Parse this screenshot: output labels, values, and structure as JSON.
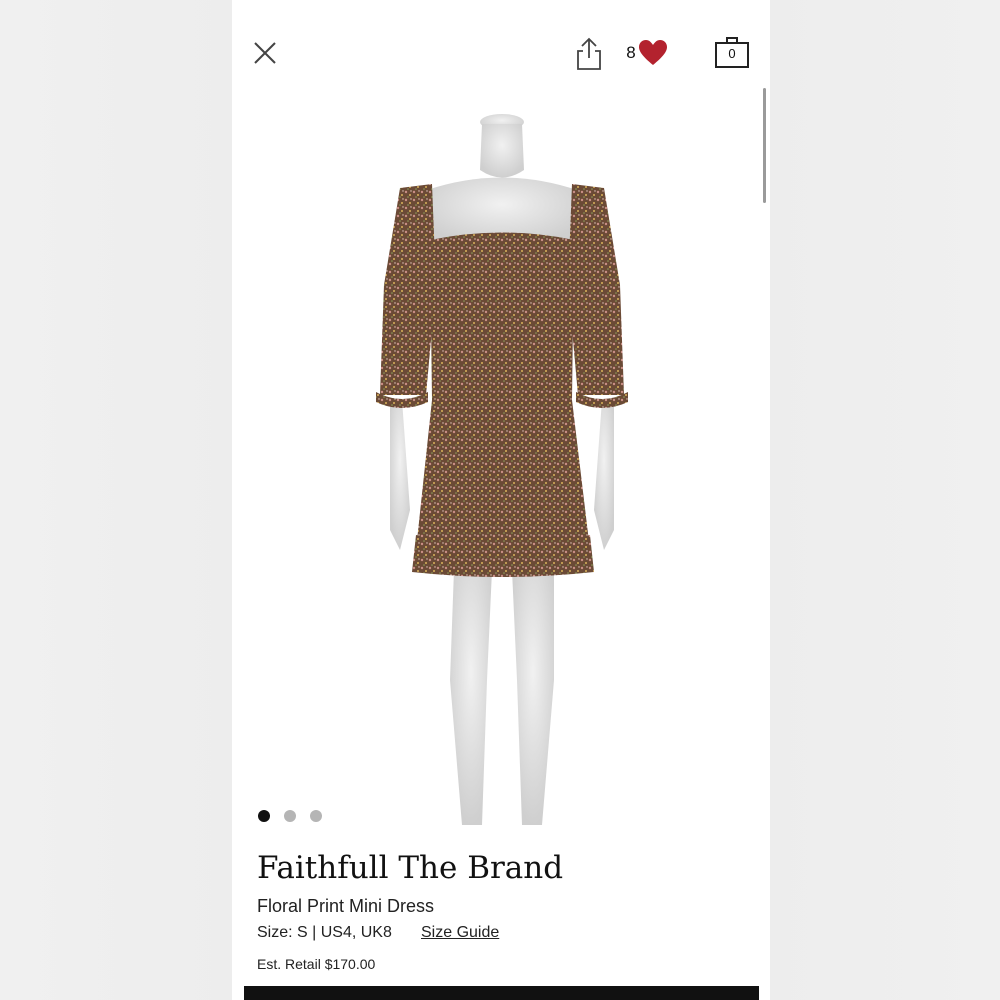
{
  "header": {
    "favorites_count": "8",
    "bag_count": "0"
  },
  "product": {
    "brand": "Faithfull The Brand",
    "name": "Floral Print Mini Dress",
    "size": "Size: S | US4, UK8",
    "size_guide_label": "Size Guide",
    "est_retail": "Est. Retail $170.00"
  },
  "gallery": {
    "image_count": 3,
    "active_index": 0
  },
  "colors": {
    "heart": "#b3222e",
    "dress": "#6b4a36",
    "mannequin": "#e3e3e3"
  },
  "icons": [
    "close-icon",
    "share-icon",
    "heart-icon",
    "bag-icon"
  ]
}
